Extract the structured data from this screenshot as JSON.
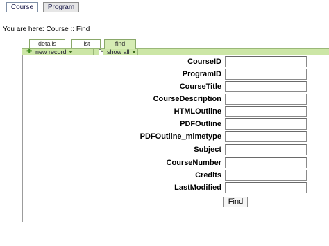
{
  "top_tabs": [
    {
      "label": "Course",
      "active": true
    },
    {
      "label": "Program",
      "active": false
    }
  ],
  "breadcrumb": {
    "prefix": "You are here:",
    "path": "Course :: Find"
  },
  "sub_tabs": [
    {
      "label": "details"
    },
    {
      "label": "list"
    },
    {
      "label": "find"
    }
  ],
  "toolbar": {
    "new_record_label": "new record",
    "show_all_label": "show all"
  },
  "form": {
    "fields": [
      {
        "label": "CourseID",
        "value": ""
      },
      {
        "label": "ProgramID",
        "value": ""
      },
      {
        "label": "CourseTitle",
        "value": ""
      },
      {
        "label": "CourseDescription",
        "value": ""
      },
      {
        "label": "HTMLOutline",
        "value": ""
      },
      {
        "label": "PDFOutline",
        "value": ""
      },
      {
        "label": "PDFOutline_mimetype",
        "value": ""
      },
      {
        "label": "Subject",
        "value": ""
      },
      {
        "label": "CourseNumber",
        "value": ""
      },
      {
        "label": "Credits",
        "value": ""
      },
      {
        "label": "LastModified",
        "value": ""
      }
    ],
    "submit_label": "Find"
  },
  "colors": {
    "toolbar_green": "#cce6a6",
    "active_subtab": "#d6ecb4"
  }
}
